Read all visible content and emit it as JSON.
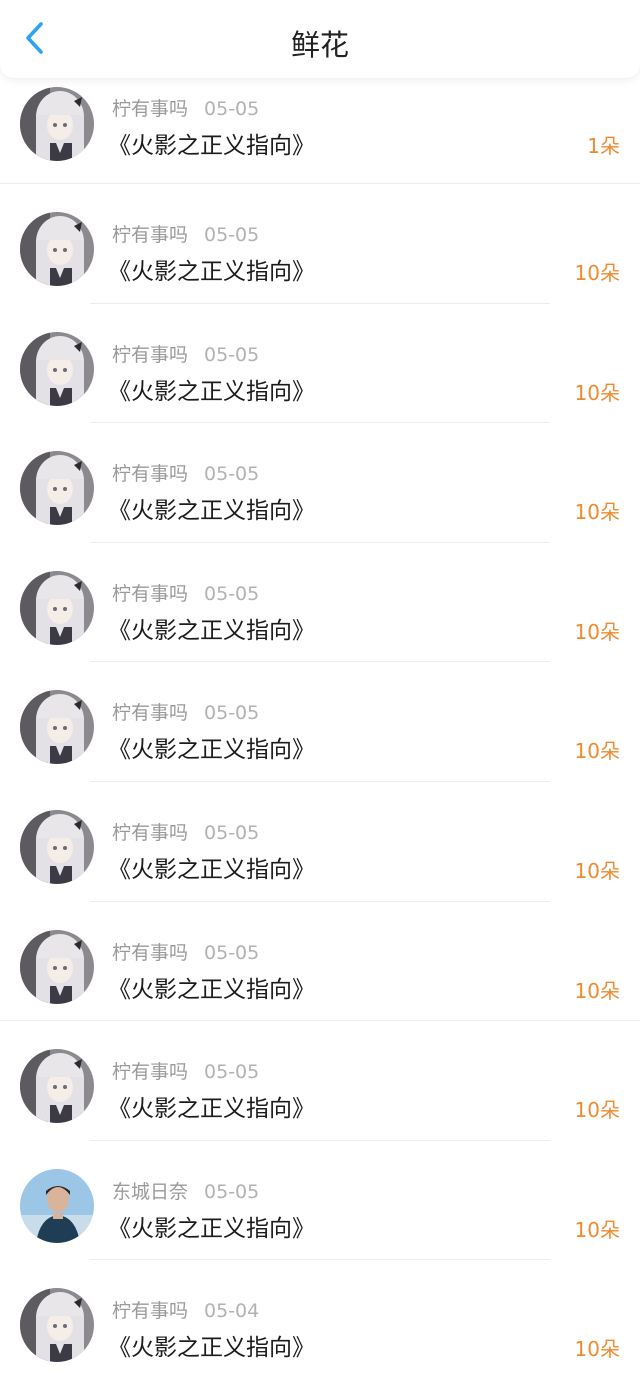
{
  "header": {
    "title": "鲜花",
    "back_icon": "chevron-left-icon",
    "accent": "#2ea3f2"
  },
  "colors": {
    "count": "#f08a2e",
    "name": "#9a9a9a",
    "date": "#b2b2b2"
  },
  "items": [
    {
      "name": "柠有事吗",
      "date": "05-05",
      "book": "《火影之正义指向》",
      "count": "1朵",
      "avatar": "anime-girl"
    },
    {
      "name": "柠有事吗",
      "date": "05-05",
      "book": "《火影之正义指向》",
      "count": "10朵",
      "avatar": "anime-girl"
    },
    {
      "name": "柠有事吗",
      "date": "05-05",
      "book": "《火影之正义指向》",
      "count": "10朵",
      "avatar": "anime-girl"
    },
    {
      "name": "柠有事吗",
      "date": "05-05",
      "book": "《火影之正义指向》",
      "count": "10朵",
      "avatar": "anime-girl"
    },
    {
      "name": "柠有事吗",
      "date": "05-05",
      "book": "《火影之正义指向》",
      "count": "10朵",
      "avatar": "anime-girl"
    },
    {
      "name": "柠有事吗",
      "date": "05-05",
      "book": "《火影之正义指向》",
      "count": "10朵",
      "avatar": "anime-girl"
    },
    {
      "name": "柠有事吗",
      "date": "05-05",
      "book": "《火影之正义指向》",
      "count": "10朵",
      "avatar": "anime-girl"
    },
    {
      "name": "柠有事吗",
      "date": "05-05",
      "book": "《火影之正义指向》",
      "count": "10朵",
      "avatar": "anime-girl"
    },
    {
      "name": "柠有事吗",
      "date": "05-05",
      "book": "《火影之正义指向》",
      "count": "10朵",
      "avatar": "anime-girl"
    },
    {
      "name": "东城日奈",
      "date": "05-05",
      "book": "《火影之正义指向》",
      "count": "10朵",
      "avatar": "boy-photo"
    },
    {
      "name": "柠有事吗",
      "date": "05-04",
      "book": "《火影之正义指向》",
      "count": "10朵",
      "avatar": "anime-girl"
    }
  ]
}
